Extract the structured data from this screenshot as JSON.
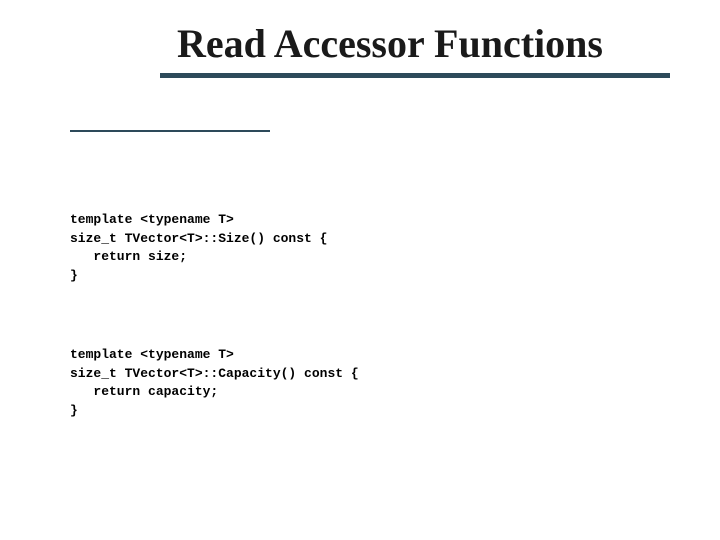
{
  "title": "Read Accessor Functions",
  "code1": "template <typename T>\nsize_t TVector<T>::Size() const {\n   return size;\n}",
  "code2": "template <typename T>\nsize_t TVector<T>::Capacity() const {\n   return capacity;\n}"
}
